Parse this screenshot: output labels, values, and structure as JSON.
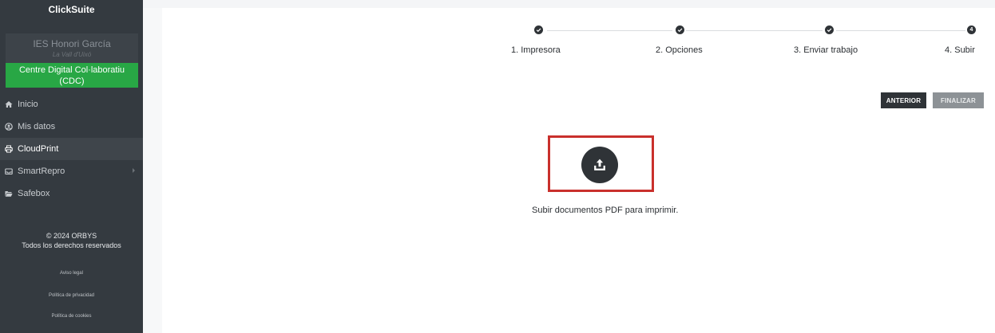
{
  "sidebar": {
    "brand": "ClickSuite",
    "org_name": "IES Honori García",
    "org_city": "La Vall d'Uixó",
    "cdc_badge": "Centre Digital Col·laboratiu (CDC)",
    "items": [
      {
        "label": "Inicio",
        "icon": "home-icon",
        "active": false
      },
      {
        "label": "Mis datos",
        "icon": "user-circle-icon",
        "active": false
      },
      {
        "label": "CloudPrint",
        "icon": "printer-icon",
        "active": true
      },
      {
        "label": "SmartRepro",
        "icon": "inbox-tray-icon",
        "active": false
      },
      {
        "label": "Safebox",
        "icon": "folder-open-icon",
        "active": false
      }
    ],
    "footer": {
      "copyright": "© 2024 ORBYS",
      "rights": "Todos los derechos reservados",
      "links": [
        "Aviso legal",
        "Política de privacidad",
        "Política de cookies"
      ]
    }
  },
  "stepper": {
    "steps": [
      {
        "label": "1. Impresora",
        "state": "done",
        "number": "1"
      },
      {
        "label": "2. Opciones",
        "state": "done",
        "number": "2"
      },
      {
        "label": "3. Enviar trabajo",
        "state": "done",
        "number": "3"
      },
      {
        "label": "4. Subir",
        "state": "current",
        "number": "4"
      }
    ]
  },
  "actions": {
    "previous": "ANTERIOR",
    "finish": "FINALIZAR"
  },
  "upload": {
    "caption": "Subir documentos PDF para imprimir.",
    "icon": "upload-icon"
  },
  "colors": {
    "sidebar_bg": "#343a40",
    "accent_green": "#28a745",
    "dark_button": "#2f3337",
    "disabled_button": "#8d9296",
    "highlight_red": "#c9302c"
  }
}
